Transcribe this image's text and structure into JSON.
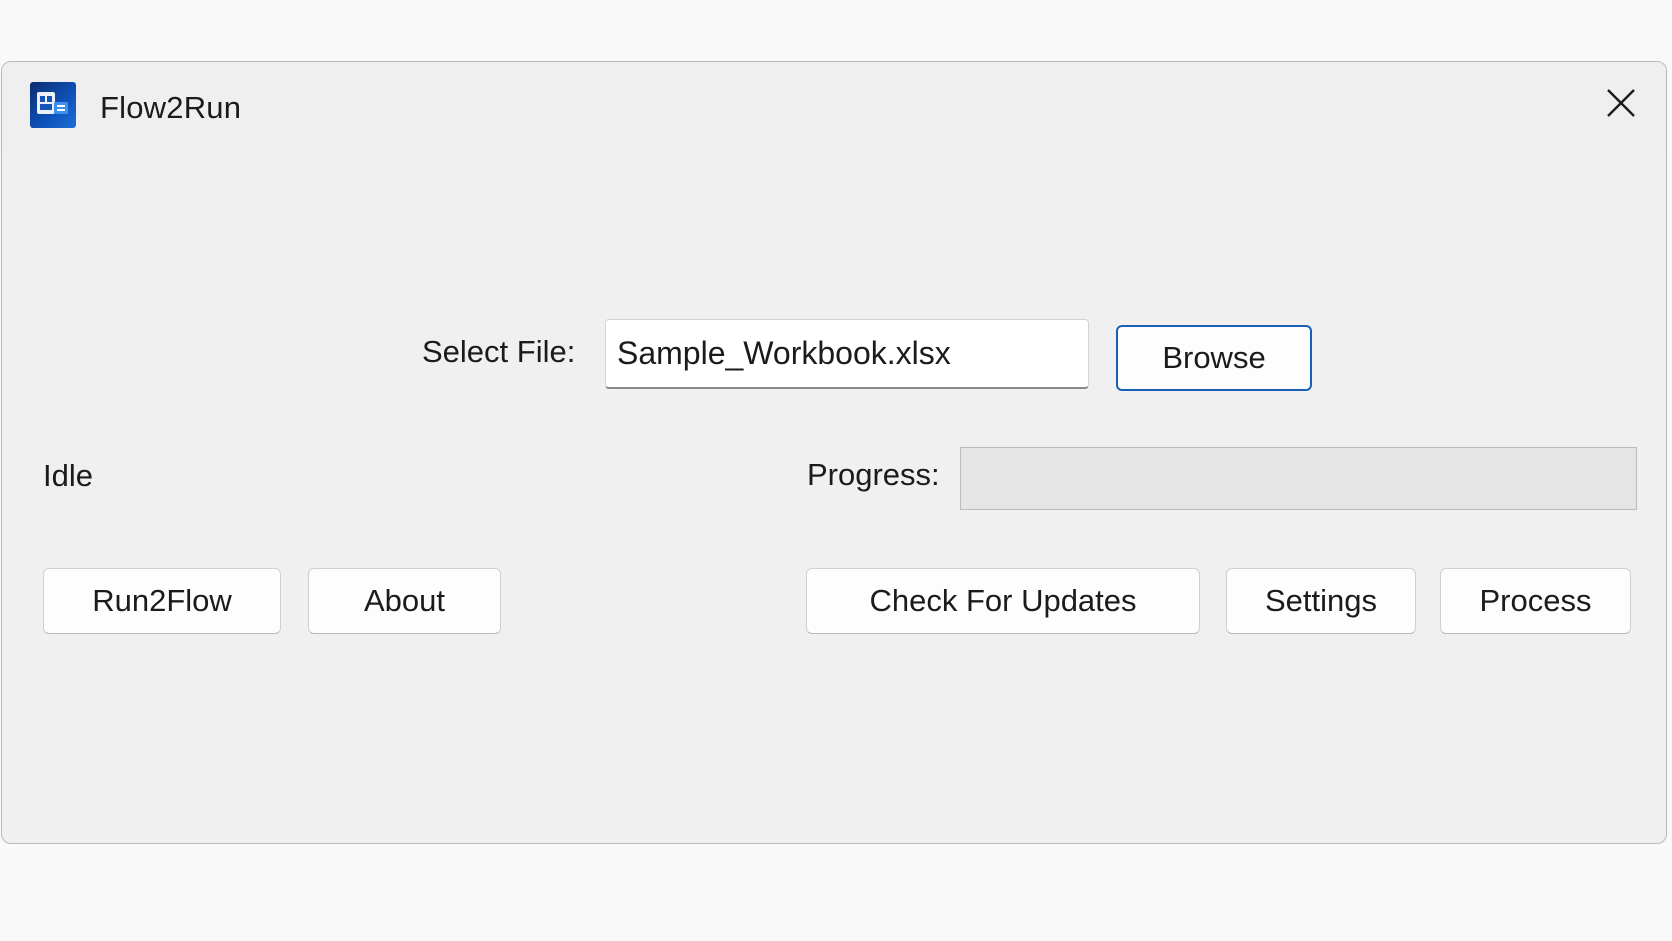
{
  "window": {
    "title": "Flow2Run",
    "app_icon": "app-logo-icon",
    "close_icon": "close-icon"
  },
  "file_picker": {
    "label": "Select File:",
    "value": "Sample_Workbook.xlsx",
    "browse_label": "Browse"
  },
  "status": {
    "text": "Idle"
  },
  "progress": {
    "label": "Progress:",
    "value_percent": 0
  },
  "buttons": {
    "run2flow": "Run2Flow",
    "about": "About",
    "check_updates": "Check For Updates",
    "settings": "Settings",
    "process": "Process"
  },
  "colors": {
    "focus_accent": "#1a5fb4",
    "progress_fill": "#06b025"
  }
}
